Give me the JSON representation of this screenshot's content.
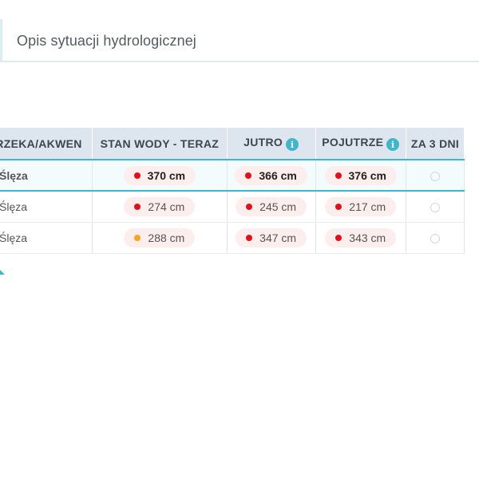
{
  "tab": {
    "title": "Opis sytuacji hydrologicznej"
  },
  "table": {
    "headers": {
      "river": "RZEKA/AKWEN",
      "now": "STAN WODY - TERAZ",
      "tomorrow": "JUTRO",
      "day_after": "POJUTRZE",
      "in3": "ZA 3 DNI"
    },
    "info_icon": "i",
    "rows": [
      {
        "river": "Ślęza",
        "now": "370 cm",
        "now_status": "red",
        "tomorrow": "366 cm",
        "tomorrow_status": "red",
        "day_after": "376 cm",
        "day_after_status": "red"
      },
      {
        "river": "Ślęza",
        "now": "274 cm",
        "now_status": "red",
        "tomorrow": "245 cm",
        "tomorrow_status": "red",
        "day_after": "217 cm",
        "day_after_status": "red"
      },
      {
        "river": "Ślęza",
        "now": "288 cm",
        "now_status": "orange",
        "tomorrow": "347 cm",
        "tomorrow_status": "red",
        "day_after": "343 cm",
        "day_after_status": "red"
      }
    ]
  },
  "colors": {
    "accent": "#3fb6cc",
    "alarm": "#e3101c",
    "warning": "#f7a51c",
    "header_bg": "#dde6ee"
  }
}
